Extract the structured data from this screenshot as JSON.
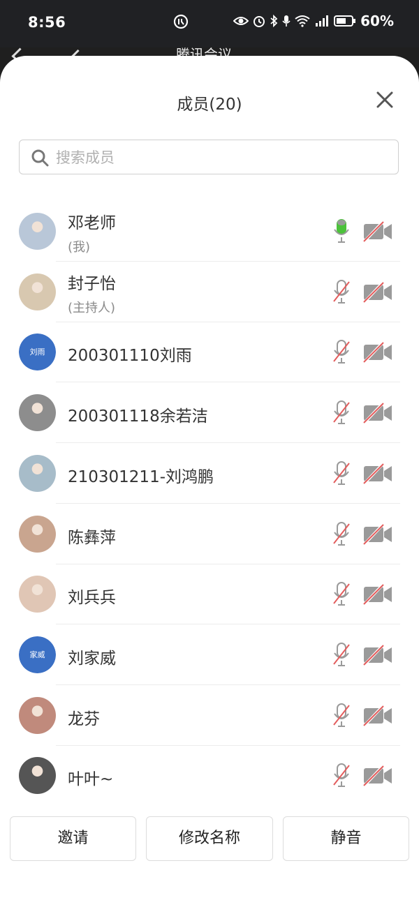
{
  "statusbar": {
    "time": "8:56",
    "battery": "60%"
  },
  "background_app": {
    "title": "腾讯会议 ⌄"
  },
  "sheet": {
    "title": "成员(20)",
    "search_placeholder": "搜索成员"
  },
  "colors": {
    "accent_blue": "#3a6fc4",
    "mic_active": "#4cc23b",
    "muted_red": "#e35d5d",
    "icon_gray": "#9a9a9a"
  },
  "members": [
    {
      "name": "邓老师",
      "subtitle": "(我)",
      "mic": "on",
      "camera": "off",
      "avatar_type": "photo"
    },
    {
      "name": "封子怡",
      "subtitle": "(主持人)",
      "mic": "off",
      "camera": "off",
      "avatar_type": "photo"
    },
    {
      "name": "200301110刘雨",
      "subtitle": "",
      "mic": "off",
      "camera": "off",
      "avatar_type": "text",
      "avatar_text": "刘雨"
    },
    {
      "name": "200301118余若洁",
      "subtitle": "",
      "mic": "off",
      "camera": "off",
      "avatar_type": "photo"
    },
    {
      "name": "210301211-刘鸿鹏",
      "subtitle": "",
      "mic": "off",
      "camera": "off",
      "avatar_type": "photo"
    },
    {
      "name": "陈彝萍",
      "subtitle": "",
      "mic": "off",
      "camera": "off",
      "avatar_type": "photo"
    },
    {
      "name": "刘兵兵",
      "subtitle": "",
      "mic": "off",
      "camera": "off",
      "avatar_type": "photo"
    },
    {
      "name": "刘家威",
      "subtitle": "",
      "mic": "off",
      "camera": "off",
      "avatar_type": "text",
      "avatar_text": "家威"
    },
    {
      "name": "龙芬",
      "subtitle": "",
      "mic": "off",
      "camera": "off",
      "avatar_type": "photo"
    },
    {
      "name": "叶叶~",
      "subtitle": "",
      "mic": "off",
      "camera": "off",
      "avatar_type": "photo"
    }
  ],
  "buttons": {
    "invite": "邀请",
    "rename": "修改名称",
    "mute": "静音"
  }
}
